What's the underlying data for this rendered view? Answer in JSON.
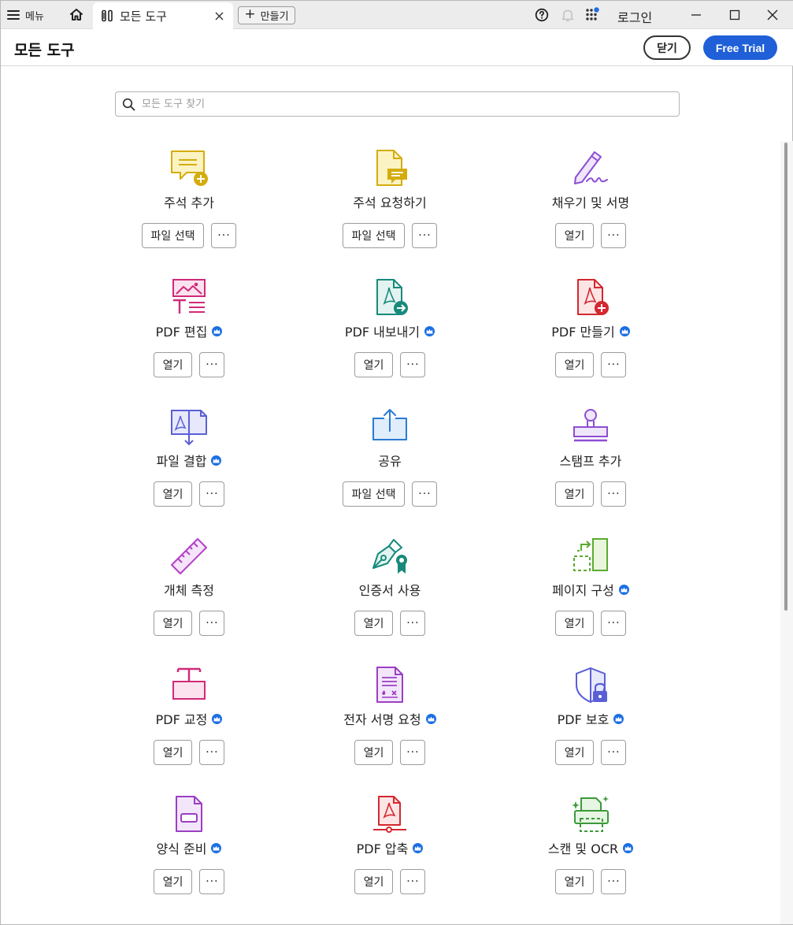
{
  "titlebar": {
    "menu_label": "메뉴",
    "tab_title": "모든 도구",
    "create_label": "만들기",
    "login_label": "로그인"
  },
  "header": {
    "title": "모든 도구",
    "close_label": "닫기",
    "trial_label": "Free Trial"
  },
  "search": {
    "placeholder": "모든 도구 찾기",
    "value": ""
  },
  "colors": {
    "accent": "#1f5fd8",
    "premium_badge": "#1b6ee3"
  },
  "tools": [
    {
      "name": "주석 추가",
      "icon": "comment-add-icon",
      "premium": false,
      "action": "파일 선택"
    },
    {
      "name": "주석 요청하기",
      "icon": "request-comment-icon",
      "premium": false,
      "action": "파일 선택"
    },
    {
      "name": "채우기 및 서명",
      "icon": "fill-sign-icon",
      "premium": false,
      "action": "열기"
    },
    {
      "name": "PDF 편집",
      "icon": "edit-pdf-icon",
      "premium": true,
      "action": "열기"
    },
    {
      "name": "PDF 내보내기",
      "icon": "export-pdf-icon",
      "premium": true,
      "action": "열기"
    },
    {
      "name": "PDF 만들기",
      "icon": "create-pdf-icon",
      "premium": true,
      "action": "열기"
    },
    {
      "name": "파일 결합",
      "icon": "combine-files-icon",
      "premium": true,
      "action": "열기"
    },
    {
      "name": "공유",
      "icon": "share-icon",
      "premium": false,
      "action": "파일 선택"
    },
    {
      "name": "스탬프 추가",
      "icon": "stamp-icon",
      "premium": false,
      "action": "열기"
    },
    {
      "name": "개체 측정",
      "icon": "ruler-icon",
      "premium": false,
      "action": "열기"
    },
    {
      "name": "인증서 사용",
      "icon": "certificate-pen-icon",
      "premium": false,
      "action": "열기"
    },
    {
      "name": "페이지 구성",
      "icon": "organize-pages-icon",
      "premium": true,
      "action": "열기"
    },
    {
      "name": "PDF 교정",
      "icon": "redact-icon",
      "premium": true,
      "action": "열기"
    },
    {
      "name": "전자 서명 요청",
      "icon": "request-esign-icon",
      "premium": true,
      "action": "열기"
    },
    {
      "name": "PDF 보호",
      "icon": "protect-pdf-icon",
      "premium": true,
      "action": "열기"
    },
    {
      "name": "양식 준비",
      "icon": "prepare-form-icon",
      "premium": true,
      "action": "열기"
    },
    {
      "name": "PDF 압축",
      "icon": "compress-pdf-icon",
      "premium": true,
      "action": "열기"
    },
    {
      "name": "스캔 및 OCR",
      "icon": "scan-ocr-icon",
      "premium": true,
      "action": "열기"
    }
  ]
}
